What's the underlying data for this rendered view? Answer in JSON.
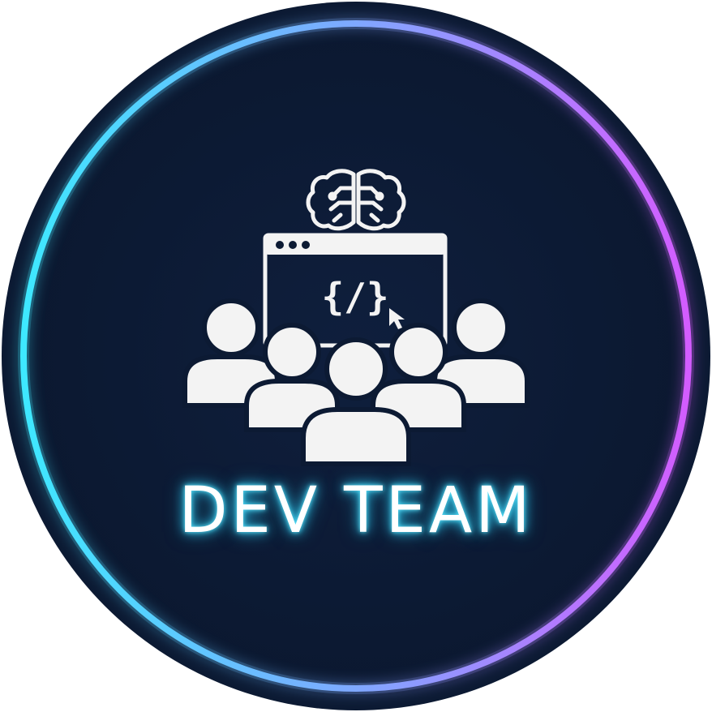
{
  "logo": {
    "title": "DEV TEAM",
    "code_glyph": "{/}",
    "icons": [
      "brain-circuit-icon",
      "code-window-icon",
      "cursor-icon",
      "team-people-icon"
    ]
  },
  "colors": {
    "background": "#0d1b36",
    "ring_start": "#3ee8ff",
    "ring_end": "#d35cff",
    "foreground": "#f3f3f3",
    "text_glow": "#2ed6ff"
  }
}
